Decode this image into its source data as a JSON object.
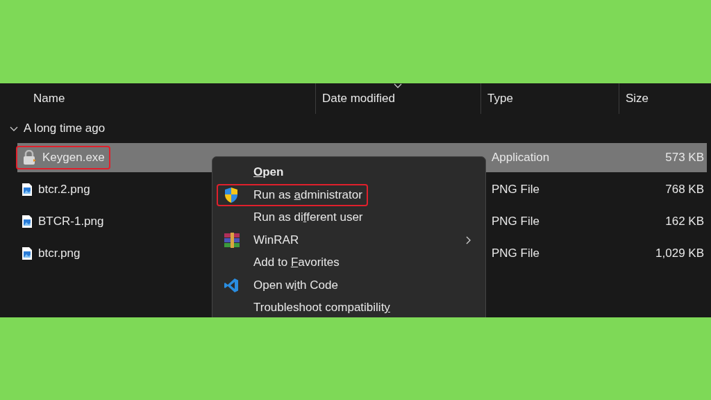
{
  "columns": [
    "Name",
    "Date modified",
    "Type",
    "Size"
  ],
  "group": {
    "label": "A long time ago",
    "expanded": true
  },
  "files": [
    {
      "kind": "app",
      "name": "Keygen.exe",
      "type": "Application",
      "size": "573 KB",
      "selected": true,
      "highlighted": true
    },
    {
      "kind": "png",
      "name": "btcr.2.png",
      "type": "PNG File",
      "size": "768 KB",
      "selected": false,
      "highlighted": false
    },
    {
      "kind": "png",
      "name": "BTCR-1.png",
      "type": "PNG File",
      "size": "162 KB",
      "selected": false,
      "highlighted": false
    },
    {
      "kind": "png",
      "name": "btcr.png",
      "type": "PNG File",
      "size": "1,029 KB",
      "selected": false,
      "highlighted": false
    }
  ],
  "context_menu": [
    {
      "kind": "plain",
      "parts": [
        {
          "text": "O",
          "underlined": true
        },
        {
          "text": "pen",
          "underlined": false
        }
      ],
      "bold": true,
      "submenu": false,
      "highlighted": false
    },
    {
      "kind": "shield",
      "parts": [
        {
          "text": "Run as ",
          "underlined": false
        },
        {
          "text": "a",
          "underlined": true
        },
        {
          "text": "dministrator",
          "underlined": false
        }
      ],
      "bold": false,
      "submenu": false,
      "highlighted": true
    },
    {
      "kind": "plain",
      "parts": [
        {
          "text": "Run as di",
          "underlined": false
        },
        {
          "text": "f",
          "underlined": true
        },
        {
          "text": "ferent user",
          "underlined": false
        }
      ],
      "bold": false,
      "submenu": false,
      "highlighted": false
    },
    {
      "kind": "archive",
      "parts": [
        {
          "text": "WinRAR",
          "underlined": false
        }
      ],
      "bold": false,
      "submenu": true,
      "highlighted": false
    },
    {
      "kind": "plain",
      "parts": [
        {
          "text": "Add to ",
          "underlined": false
        },
        {
          "text": "F",
          "underlined": true
        },
        {
          "text": "avorites",
          "underlined": false
        }
      ],
      "bold": false,
      "submenu": false,
      "highlighted": false
    },
    {
      "kind": "code",
      "parts": [
        {
          "text": "Open w",
          "underlined": false
        },
        {
          "text": "i",
          "underlined": true
        },
        {
          "text": "th Code",
          "underlined": false
        }
      ],
      "bold": false,
      "submenu": false,
      "highlighted": false
    },
    {
      "kind": "plain",
      "parts": [
        {
          "text": "Troubleshoot compatibilit",
          "underlined": false
        },
        {
          "text": "y",
          "underlined": true
        }
      ],
      "bold": false,
      "submenu": false,
      "highlighted": false
    }
  ]
}
